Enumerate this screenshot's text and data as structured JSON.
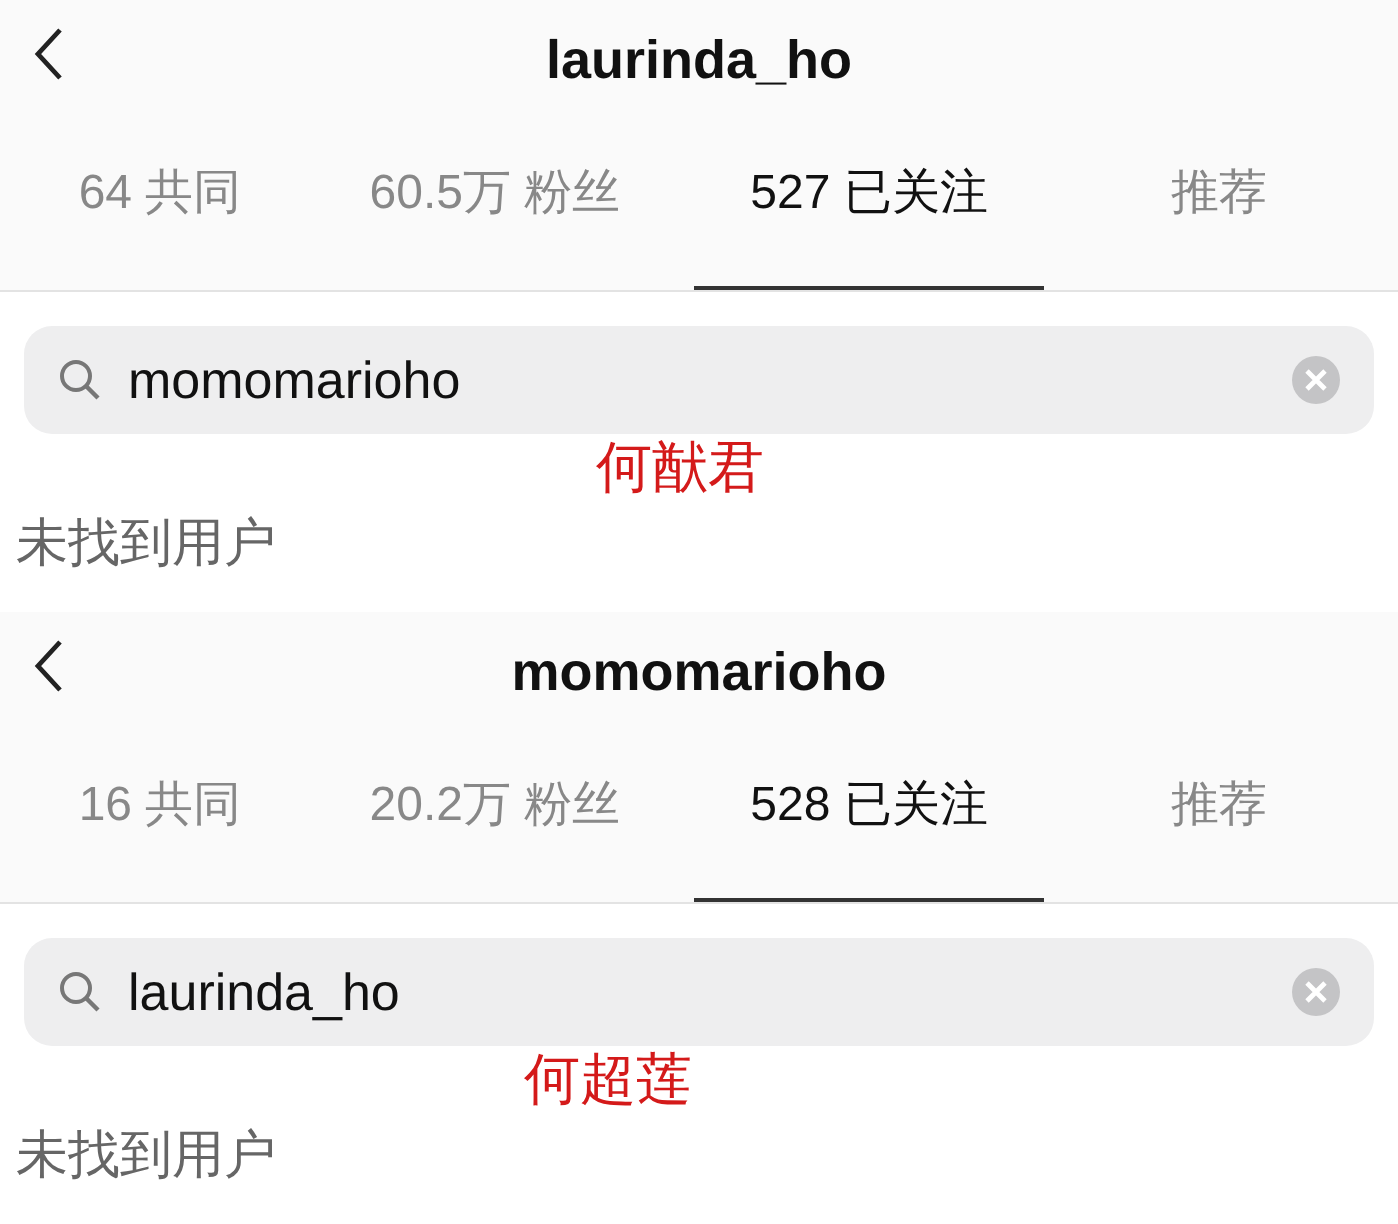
{
  "panels": [
    {
      "title": "laurinda_ho",
      "tabs": [
        {
          "label": "64 共同",
          "selected": false
        },
        {
          "label": "60.5万 粉丝",
          "selected": false
        },
        {
          "label": "527 已关注",
          "selected": true
        },
        {
          "label": "推荐",
          "selected": false
        }
      ],
      "search": {
        "value": "momomarioho"
      },
      "annotation": "何猷君",
      "message": "未找到用户"
    },
    {
      "title": "momomarioho",
      "tabs": [
        {
          "label": "16 共同",
          "selected": false
        },
        {
          "label": "20.2万 粉丝",
          "selected": false
        },
        {
          "label": "528 已关注",
          "selected": true
        },
        {
          "label": "推荐",
          "selected": false
        }
      ],
      "search": {
        "value": "laurinda_ho"
      },
      "annotation": "何超莲",
      "message": "未找到用户"
    }
  ]
}
